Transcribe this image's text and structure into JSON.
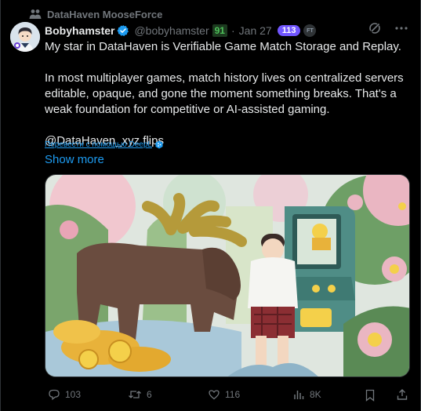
{
  "social_context": {
    "text": "DataHaven MooseForce",
    "icon": "community-icon"
  },
  "author": {
    "name": "Bobyhamster",
    "handle": "@bobyhamster",
    "score": "91",
    "date": "Jan 27",
    "badge": "113",
    "badge_small": "FT"
  },
  "tweet": {
    "para1": "My star in DataHaven is Verifiable Game Match Storage and Replay.",
    "para2": "In most multiplayer games, match history lives on centralized servers editable, opaque, and gone the moment something breaks. That's a weak foundation for competitive or AI-assisted gaming.",
    "para3": "@DataHaven_xyz flips",
    "translate": "Перевести с помощью DeepL",
    "show_more": "Show more"
  },
  "actions": {
    "replies": "103",
    "reposts": "6",
    "likes": "116",
    "views": "8K"
  },
  "colors": {
    "accent": "#1d9bf0",
    "muted": "#71767b",
    "badge": "#7156ff",
    "score": "#4ec15a"
  }
}
